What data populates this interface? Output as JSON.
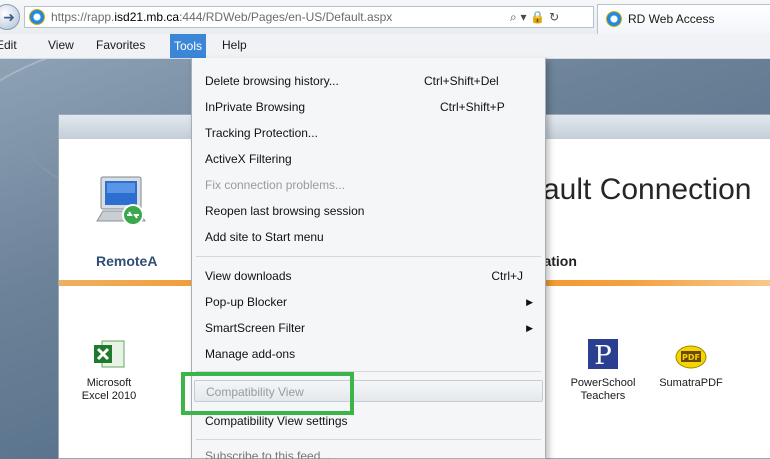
{
  "address_bar": {
    "url_prefix": "https://rapp.",
    "url_domain": "isd21.mb.ca",
    "url_suffix": ":444/RDWeb/Pages/en-US/Default.aspx",
    "url_icons": "⌕ ▾ 🔒 ↻"
  },
  "tab": {
    "title": "RD Web Access"
  },
  "menu_bar": {
    "items": [
      "Edit",
      "View",
      "Favorites",
      "Tools",
      "Help"
    ],
    "edit_visible": "Edit"
  },
  "page": {
    "title_partial": "ault Connection",
    "nav_remote_partial": "RemoteA",
    "nav_config_partial": "ration",
    "apps": [
      {
        "name_line1": "Microsoft",
        "name_line2": "Excel 2010",
        "icon": "excel-icon"
      },
      {
        "name_line1": "PowerSchool",
        "name_line2": "Teachers",
        "icon": "powerschool-icon"
      },
      {
        "name_line1": "SumatraPDF",
        "name_line2": "",
        "icon": "sumatrapdf-icon"
      }
    ]
  },
  "tools_menu": {
    "items": [
      {
        "label": "Delete browsing history...",
        "shortcut": "Ctrl+Shift+Del"
      },
      {
        "label": "InPrivate Browsing",
        "shortcut": "Ctrl+Shift+P"
      },
      {
        "label": "Tracking Protection..."
      },
      {
        "label": "ActiveX Filtering"
      },
      {
        "label": "Fix connection problems...",
        "disabled": true
      },
      {
        "label": "Reopen last browsing session"
      },
      {
        "label": "Add site to Start menu"
      },
      {
        "label": "View downloads",
        "shortcut": "Ctrl+J"
      },
      {
        "label": "Pop-up Blocker",
        "submenu": true
      },
      {
        "label": "SmartScreen Filter",
        "submenu": true
      },
      {
        "label": "Manage add-ons"
      },
      {
        "label": "Compatibility View",
        "disabled": true,
        "highlighted": true
      },
      {
        "label": "Compatibility View settings"
      },
      {
        "label": "Subscribe to this feed..."
      }
    ]
  },
  "colors": {
    "menu_active": "#3b86d6",
    "highlight_box": "#3bb54a",
    "orange_bar": "#f08a10"
  }
}
